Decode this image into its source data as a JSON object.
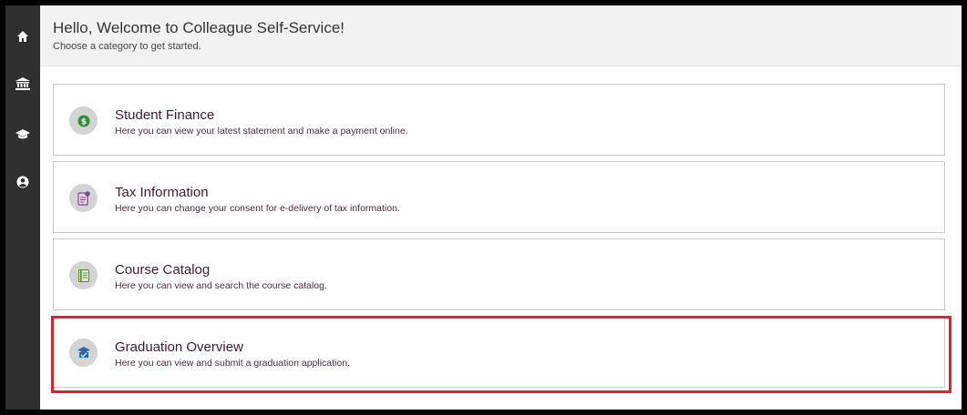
{
  "header": {
    "title": "Hello, Welcome to Colleague Self-Service!",
    "subtitle": "Choose a category to get started."
  },
  "sidebar": {
    "items": [
      {
        "icon": "home-icon"
      },
      {
        "icon": "bank-icon"
      },
      {
        "icon": "graduation-cap-icon"
      },
      {
        "icon": "user-circle-icon"
      }
    ]
  },
  "cards": [
    {
      "title": "Student Finance",
      "description": "Here you can view your latest statement and make a payment online.",
      "icon": "dollar-icon",
      "icon_color": "#3a8a3a"
    },
    {
      "title": "Tax Information",
      "description": "Here you can change your consent for e-delivery of tax information.",
      "icon": "tax-document-icon",
      "icon_color": "#7a4a8a"
    },
    {
      "title": "Course Catalog",
      "description": "Here you can view and search the course catalog.",
      "icon": "book-icon",
      "icon_color": "#5a8a3a"
    },
    {
      "title": "Graduation Overview",
      "description": "Here you can view and submit a graduation application.",
      "icon": "graduation-icon",
      "icon_color": "#2a6aa8"
    }
  ],
  "colors": {
    "sidebar_bg": "#2f2f2f",
    "header_bg": "#f2f2f2",
    "highlight": "#e0202a",
    "title_text": "#3b1e2e"
  }
}
